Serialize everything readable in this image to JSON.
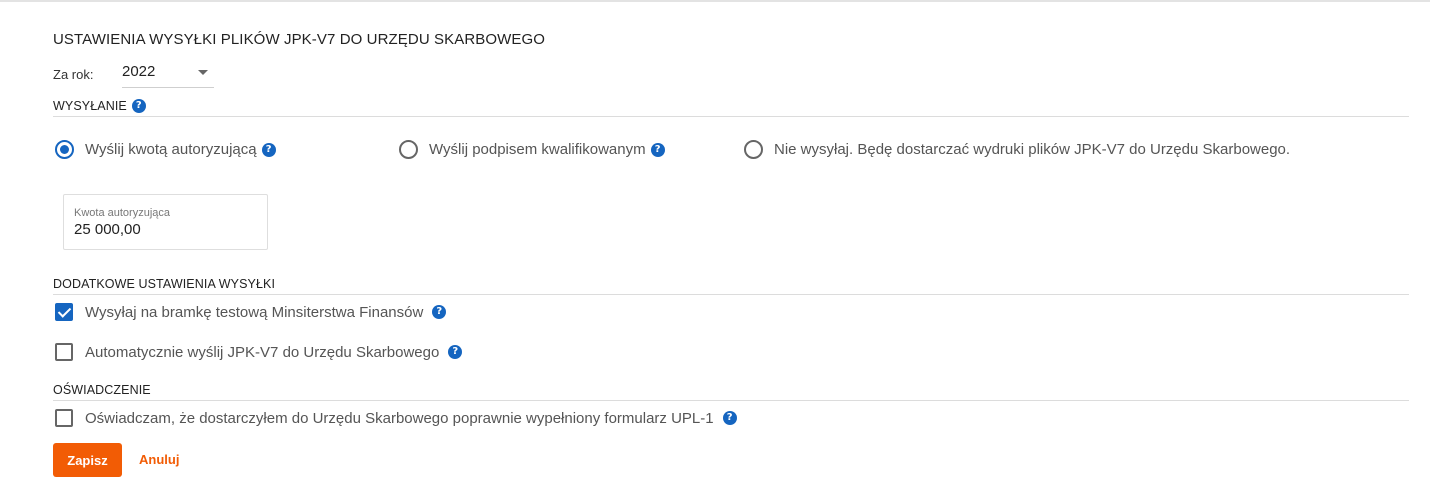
{
  "page_title": "USTAWIENIA WYSYŁKI PLIKÓW JPK-V7 DO URZĘDU SKARBOWEGO",
  "year": {
    "label": "Za rok:",
    "value": "2022"
  },
  "sending": {
    "title": "WYSYŁANIE",
    "options": [
      {
        "label": "Wyślij kwotą autoryzującą",
        "selected": true,
        "has_help": true
      },
      {
        "label": "Wyślij podpisem kwalifikowanym",
        "selected": false,
        "has_help": true
      },
      {
        "label": "Nie wysyłaj. Będę dostarczać wydruki plików JPK-V7 do Urzędu Skarbowego.",
        "selected": false,
        "has_help": false
      }
    ],
    "amount": {
      "label": "Kwota autoryzująca",
      "value": "25 000,00"
    }
  },
  "additional": {
    "title": "DODATKOWE USTAWIENIA WYSYŁKI",
    "options": [
      {
        "label": "Wysyłaj na bramkę testową Minsiterstwa Finansów",
        "checked": true
      },
      {
        "label": "Automatycznie wyślij JPK-V7 do Urzędu Skarbowego",
        "checked": false
      }
    ]
  },
  "declaration": {
    "title": "OŚWIADCZENIE",
    "label": "Oświadczam, że dostarczyłem do Urzędu Skarbowego poprawnie wypełniony formularz UPL-1",
    "checked": false
  },
  "actions": {
    "save_label": "Zapisz",
    "cancel_label": "Anuluj"
  },
  "help_glyph": "?",
  "colors": {
    "accent": "#1565c0",
    "primary_button": "#f25c05"
  },
  "icons": {
    "help": "question-circle-icon",
    "dropdown": "caret-down-icon"
  }
}
